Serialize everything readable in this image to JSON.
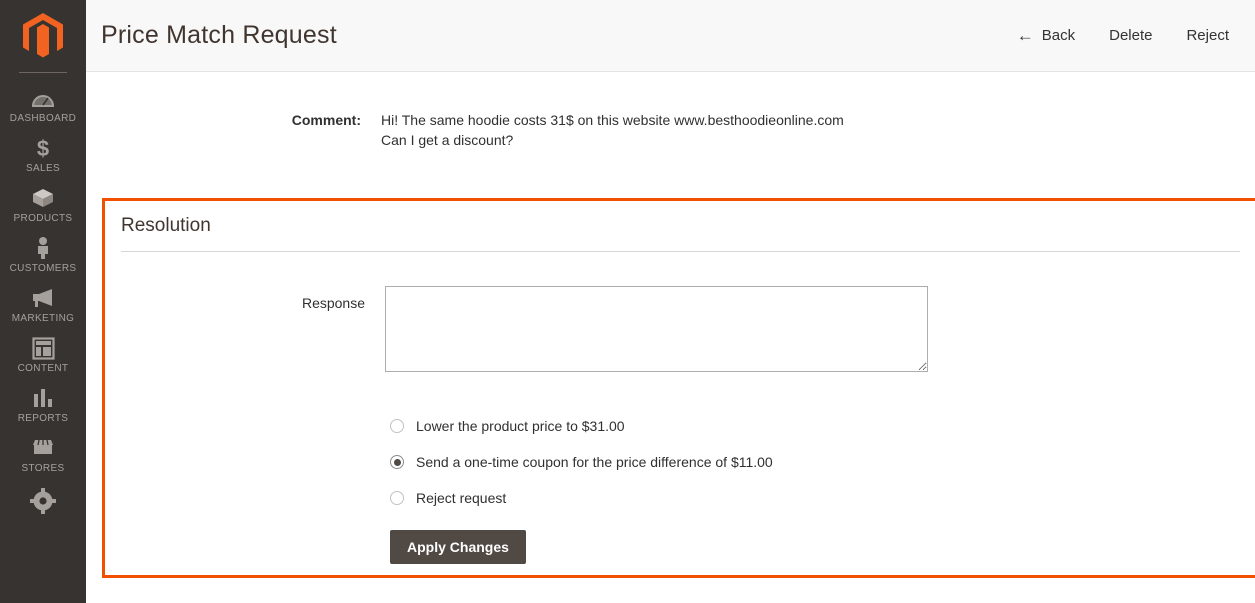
{
  "colors": {
    "accent_orange": "#f05000",
    "sidebar_bg": "#373330",
    "header_bg": "#f8f8f8",
    "button_dark": "#514943",
    "text_dark": "#303030"
  },
  "sidebar": {
    "logo_name": "magento-logo",
    "items": [
      {
        "label": "Dashboard",
        "icon": "dashboard-icon"
      },
      {
        "label": "Sales",
        "icon": "sales-dollar-icon"
      },
      {
        "label": "Products",
        "icon": "products-box-icon"
      },
      {
        "label": "Customers",
        "icon": "customers-person-icon"
      },
      {
        "label": "Marketing",
        "icon": "marketing-megaphone-icon"
      },
      {
        "label": "Content",
        "icon": "content-layout-icon"
      },
      {
        "label": "Reports",
        "icon": "reports-bar-chart-icon"
      },
      {
        "label": "Stores",
        "icon": "stores-storefront-icon"
      },
      {
        "label": "",
        "icon": "system-gear-icon"
      }
    ]
  },
  "header": {
    "title": "Price Match Request",
    "back_label": "Back",
    "back_icon": "arrow-left-icon",
    "delete_label": "Delete",
    "reject_label": "Reject"
  },
  "comment": {
    "label": "Comment:",
    "line1": "Hi! The same hoodie costs 31$ on this website www.besthoodieonline.com",
    "line2": "Can I get a discount?"
  },
  "resolution": {
    "title": "Resolution",
    "response_label": "Response",
    "response_value": "",
    "response_placeholder": "",
    "options": [
      {
        "label": "Lower the product price to $31.00",
        "checked": false
      },
      {
        "label": "Send a one-time coupon for the price difference of $11.00",
        "checked": true
      },
      {
        "label": "Reject request",
        "checked": false
      }
    ],
    "apply_label": "Apply Changes"
  }
}
